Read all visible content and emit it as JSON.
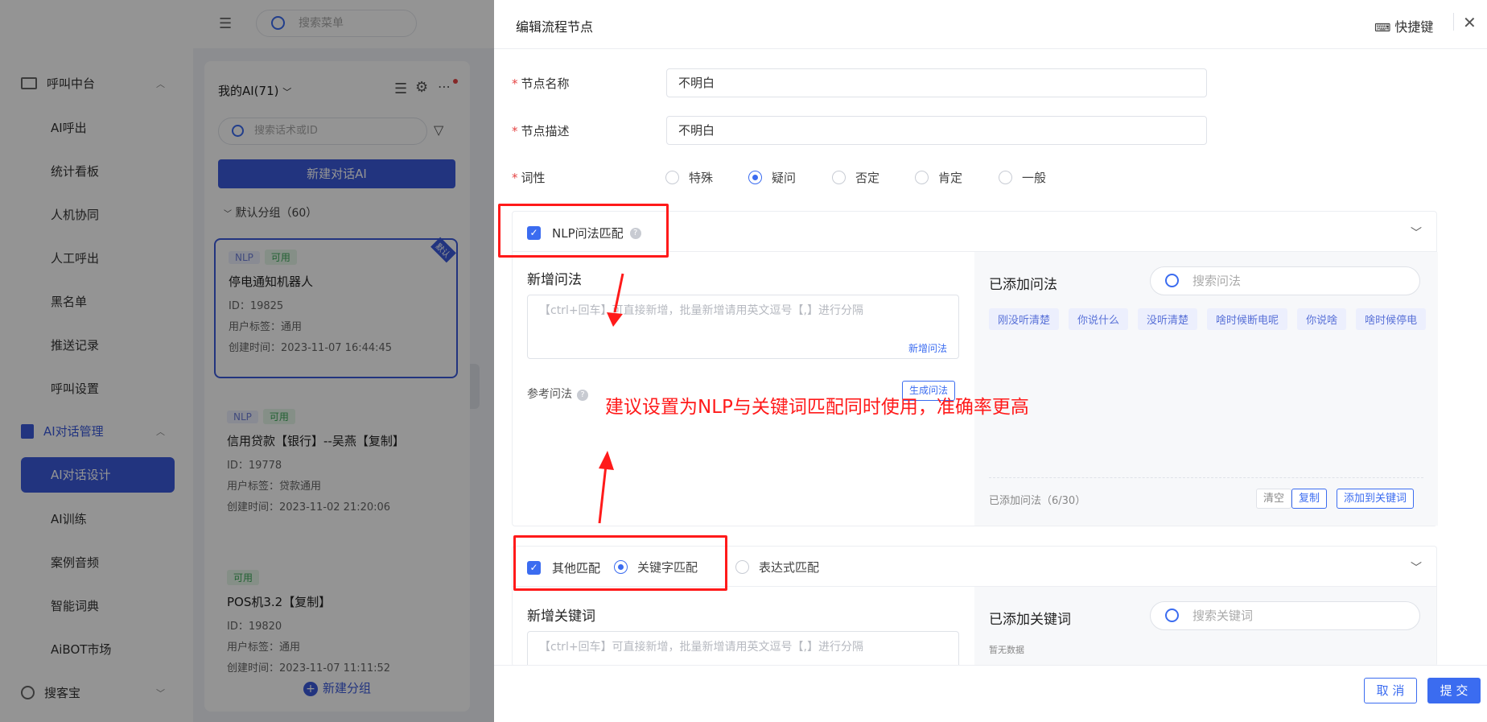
{
  "background": {
    "search_placeholder": "搜索菜单",
    "nav": {
      "group1": "呼叫中台",
      "group1_items": [
        "AI呼出",
        "统计看板",
        "人机协同",
        "人工呼出",
        "黑名单",
        "推送记录",
        "呼叫设置"
      ],
      "group2": "AI对话管理",
      "active_item": "AI对话设计",
      "group2_items": [
        "AI训练",
        "案例音频",
        "智能词典",
        "AiBOT市场"
      ],
      "group3": "搜客宝"
    },
    "list": {
      "title": "我的AI(71)",
      "search_placeholder": "搜索话术或ID",
      "new_button": "新建对话AI",
      "group_label": "默认分组（60）",
      "new_group": "新建分组",
      "default_ribbon": "默认",
      "cards": [
        {
          "tags": [
            "NLP",
            "可用"
          ],
          "title": "停电通知机器人",
          "id": "ID：19825",
          "label": "用户标签：通用",
          "created": "创建时间：2023-11-07 16:44:45"
        },
        {
          "tags": [
            "NLP",
            "可用"
          ],
          "title": "信用贷款【银行】--吴燕【复制】",
          "id": "ID：19778",
          "label": "用户标签：贷款通用",
          "created": "创建时间：2023-11-02 21:20:06"
        },
        {
          "tags": [
            "可用"
          ],
          "title": "POS机3.2【复制】",
          "id": "ID：19820",
          "label": "用户标签：通用",
          "created": "创建时间：2023-11-07 11:11:52"
        }
      ]
    }
  },
  "drawer": {
    "title": "编辑流程节点",
    "shortcut_label": "快捷键",
    "fields": {
      "name_label": "节点名称",
      "name_value": "不明白",
      "desc_label": "节点描述",
      "desc_value": "不明白",
      "pos_label": "词性",
      "pos_options": [
        "特殊",
        "疑问",
        "否定",
        "肯定",
        "一般"
      ],
      "pos_selected": "疑问"
    },
    "nlp": {
      "title": "NLP问法匹配",
      "new_title": "新增问法",
      "new_placeholder": "【ctrl+回车】可直接新增，批量新增请用英文逗号【,】进行分隔",
      "new_button": "新增问法",
      "ref_label": "参考问法",
      "gen_button": "生成问法",
      "added_title": "已添加问法",
      "search_placeholder": "搜索问法",
      "chips": [
        "刚没听清楚",
        "你说什么",
        "没听清楚",
        "啥时候断电呢",
        "你说啥",
        "啥时候停电"
      ],
      "count": "已添加问法（6/30）",
      "clear": "清空",
      "copy": "复制",
      "add_to_kw": "添加到关键词"
    },
    "other": {
      "title": "其他匹配",
      "options": [
        "关键字匹配",
        "表达式匹配"
      ],
      "selected": "关键字匹配",
      "new_title": "新增关键词",
      "new_placeholder": "【ctrl+回车】可直接新增，批量新增请用英文逗号【,】进行分隔",
      "added_title": "已添加关键词",
      "search_placeholder": "搜索关键词",
      "empty": "暂无数据"
    },
    "footer": {
      "cancel": "取 消",
      "submit": "提 交"
    }
  },
  "annotation": {
    "text": "建议设置为NLP与关键词匹配同时使用，准确率更高",
    "color": "#ff1a1a"
  },
  "colors": {
    "accent": "#3b6cf0",
    "nav_active": "#3b5bdb",
    "required": "#e54545"
  }
}
